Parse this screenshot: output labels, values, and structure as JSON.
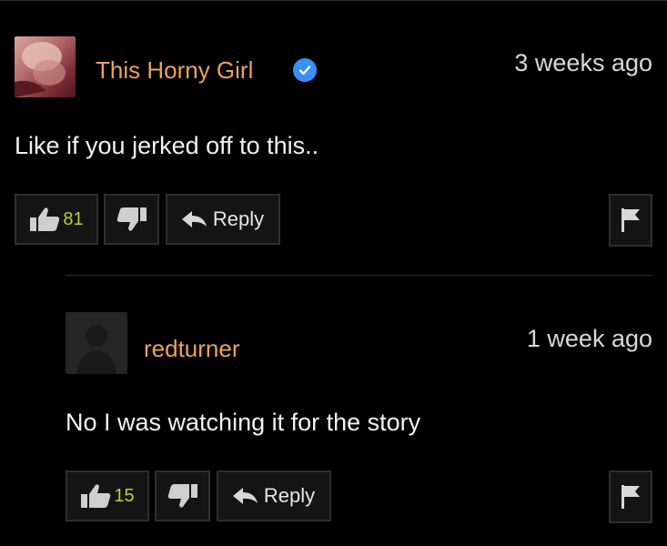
{
  "comments": [
    {
      "username": "This Horny Girl",
      "verified": true,
      "time": "3 weeks ago",
      "text": "Like if you jerked off to this..",
      "likes": "81",
      "reply_label": "Reply",
      "icons": {
        "like": "thumbs-up-icon",
        "dislike": "thumbs-down-icon",
        "reply": "reply-arrow-icon",
        "flag": "flag-icon"
      }
    },
    {
      "username": "redturner",
      "verified": false,
      "time": "1 week ago",
      "text": "No I was watching it for the story",
      "likes": "15",
      "reply_label": "Reply",
      "icons": {
        "like": "thumbs-up-icon",
        "dislike": "thumbs-down-icon",
        "reply": "reply-arrow-icon",
        "flag": "flag-icon"
      }
    }
  ],
  "colors": {
    "background": "#000000",
    "username": "#e9a25e",
    "like_count": "#b5cf42",
    "verified_badge": "#3b8ef5"
  }
}
